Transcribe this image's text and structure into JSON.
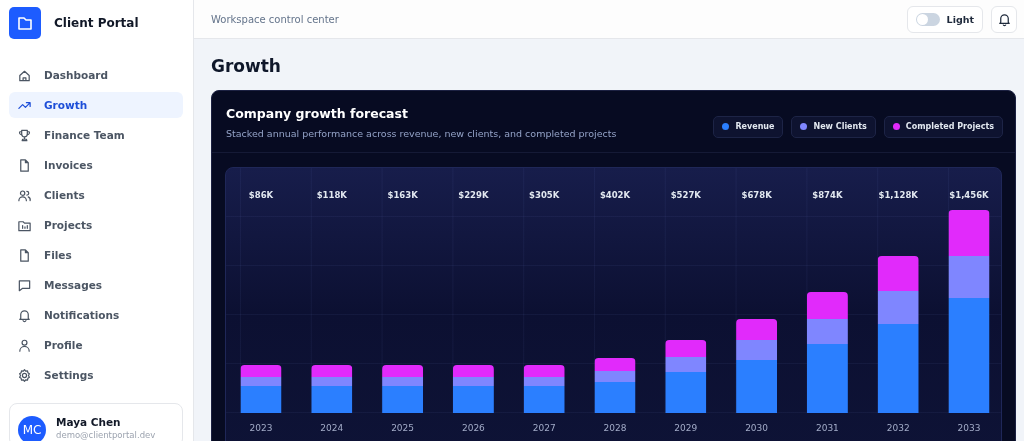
{
  "brand": {
    "name": "Client Portal"
  },
  "sidebar": {
    "items": [
      {
        "label": "Dashboard",
        "selected": false
      },
      {
        "label": "Growth",
        "selected": true
      },
      {
        "label": "Finance Team",
        "selected": false
      },
      {
        "label": "Invoices",
        "selected": false
      },
      {
        "label": "Clients",
        "selected": false
      },
      {
        "label": "Projects",
        "selected": false
      },
      {
        "label": "Files",
        "selected": false
      },
      {
        "label": "Messages",
        "selected": false
      },
      {
        "label": "Notifications",
        "selected": false
      },
      {
        "label": "Profile",
        "selected": false
      },
      {
        "label": "Settings",
        "selected": false
      }
    ]
  },
  "user": {
    "initials": "MC",
    "name": "Maya Chen",
    "email": "demo@clientportal.dev"
  },
  "topbar": {
    "subtitle": "Workspace control center",
    "theme_toggle": {
      "label": "Light",
      "on": false
    }
  },
  "page": {
    "title": "Growth"
  },
  "card": {
    "title": "Company growth forecast",
    "subtitle": "Stacked annual performance across revenue, new clients, and completed projects",
    "legend": [
      {
        "label": "Revenue",
        "color": "#2b7fff"
      },
      {
        "label": "New Clients",
        "color": "#7f86ff"
      },
      {
        "label": "Completed Projects",
        "color": "#e12afb"
      }
    ],
    "columns": [
      {
        "total": "$86K",
        "year": "2023"
      },
      {
        "total": "$118K",
        "year": "2024"
      },
      {
        "total": "$163K",
        "year": "2025"
      },
      {
        "total": "$229K",
        "year": "2026"
      },
      {
        "total": "$305K",
        "year": "2027"
      },
      {
        "total": "$402K",
        "year": "2028"
      },
      {
        "total": "$527K",
        "year": "2029"
      },
      {
        "total": "$678K",
        "year": "2030"
      },
      {
        "total": "$874K",
        "year": "2031"
      },
      {
        "total": "$1,128K",
        "year": "2032"
      },
      {
        "total": "$1,456K",
        "year": "2033"
      }
    ]
  }
}
